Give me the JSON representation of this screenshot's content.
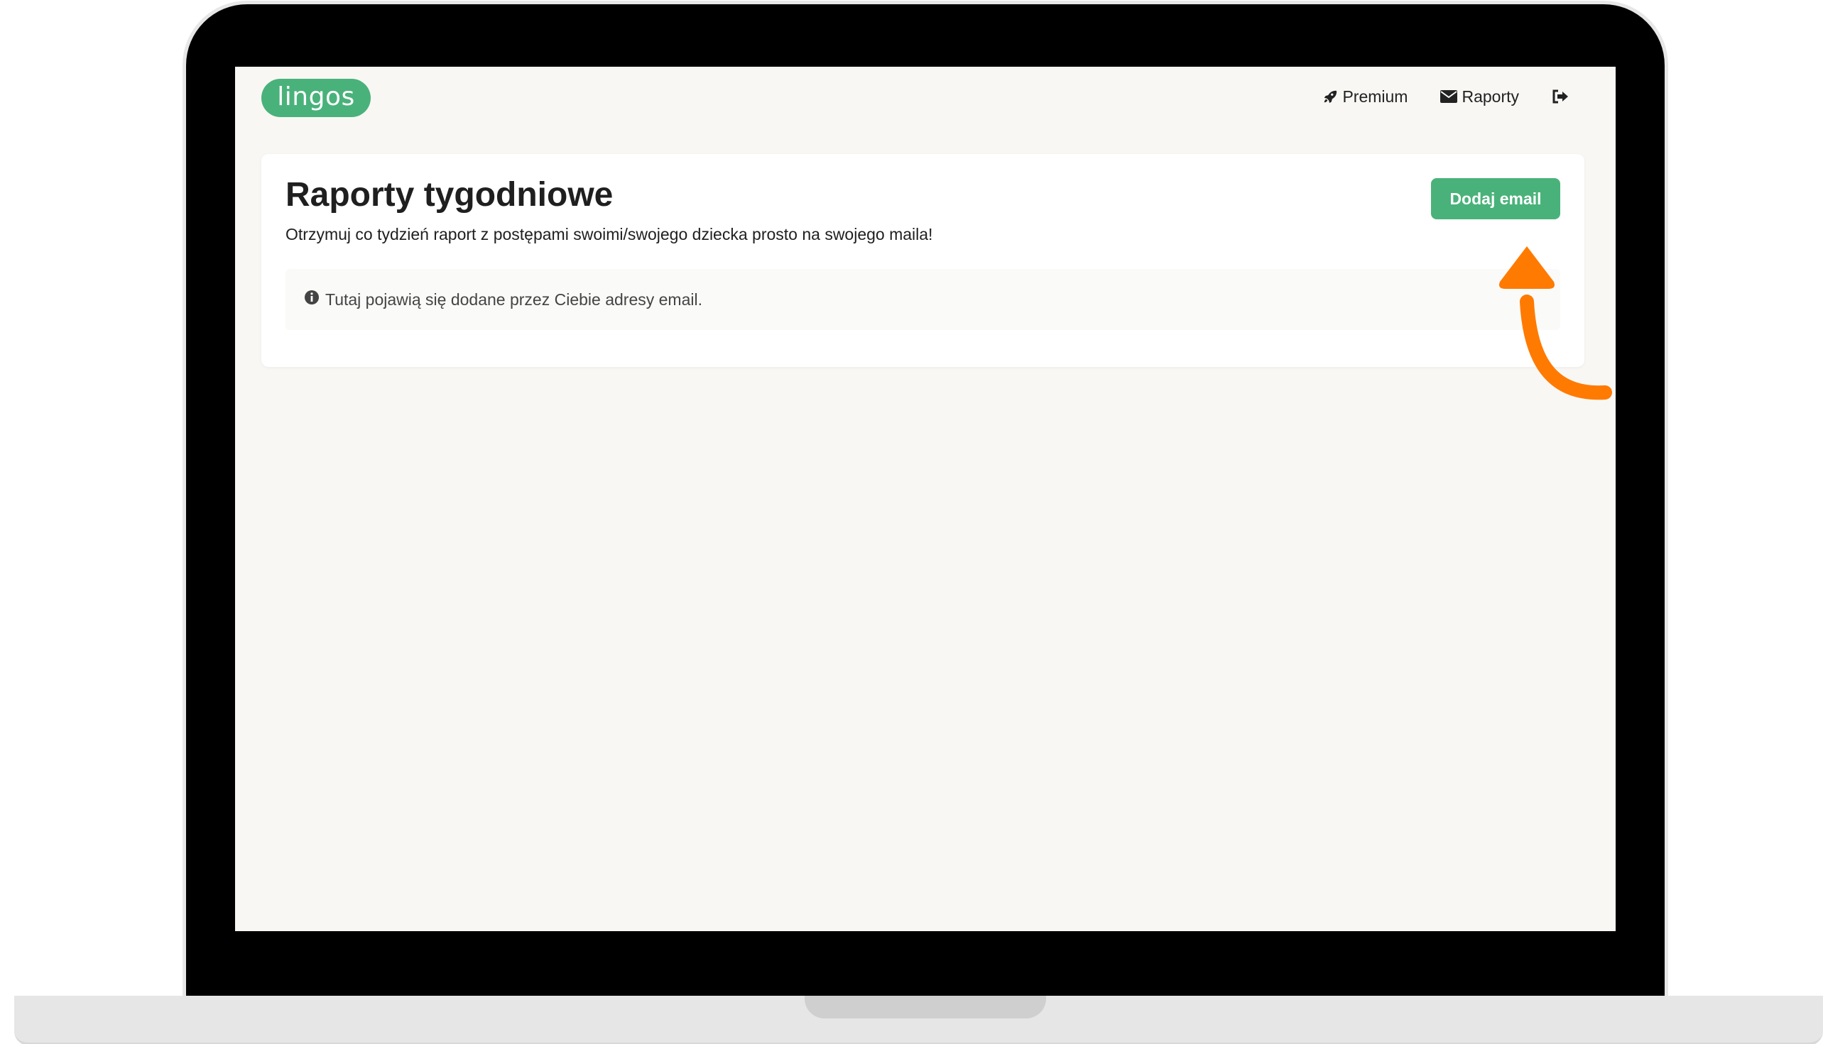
{
  "app": {
    "logo_text": "lingos",
    "brand_color": "#49b27a",
    "accent_color": "#ff7a00"
  },
  "nav": {
    "items": [
      {
        "label": "Premium",
        "icon": "rocket-icon"
      },
      {
        "label": "Raporty",
        "icon": "envelope-icon"
      },
      {
        "label": "",
        "icon": "logout-icon"
      }
    ]
  },
  "main": {
    "title": "Raporty tygodniowe",
    "subtitle": "Otrzymuj co tydzień raport z postępami swoimi/swojego dziecka prosto na swojego maila!",
    "add_button_label": "Dodaj email",
    "info_icon": "info-circle-icon",
    "empty_message": "Tutaj pojawią się dodane przez Ciebie adresy email."
  },
  "annotation": {
    "icon": "curved-arrow-icon",
    "color": "#ff7a00"
  }
}
